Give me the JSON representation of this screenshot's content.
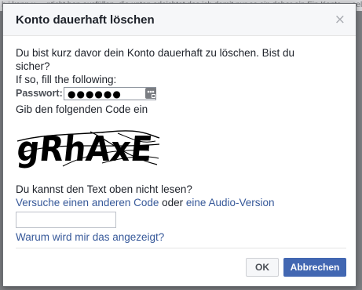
{
  "background_text": "h i kann u ... nticht hen ausfüllen, die unten erleichtet das ich damit nur as ein daher ein Ein Konto ... selbsten hat",
  "dialog": {
    "title": "Konto dauerhaft löschen",
    "close_glyph": "×",
    "intro": "Du bist kurz davor dein Konto dauerhaft zu löschen. Bist du sicher?",
    "fill_prompt": "If so, fill the following:",
    "password_label": "Passwort:",
    "password_value": "●●●●●●",
    "captcha_label": "Gib den folgenden Code ein",
    "captcha_text": "gRhAxE",
    "question": "Du kannst den Text oben nicht lesen?",
    "link_other_code": "Versuche einen anderen Code",
    "or_text": " oder ",
    "link_audio": "eine Audio-Version",
    "code_input_value": "",
    "why_link": "Warum wird mir das angezeigt?",
    "ok_label": "OK",
    "cancel_label": "Abbrechen"
  },
  "colors": {
    "link": "#365899",
    "primary_button": "#4267b2",
    "overlay": "#7d7f83"
  }
}
